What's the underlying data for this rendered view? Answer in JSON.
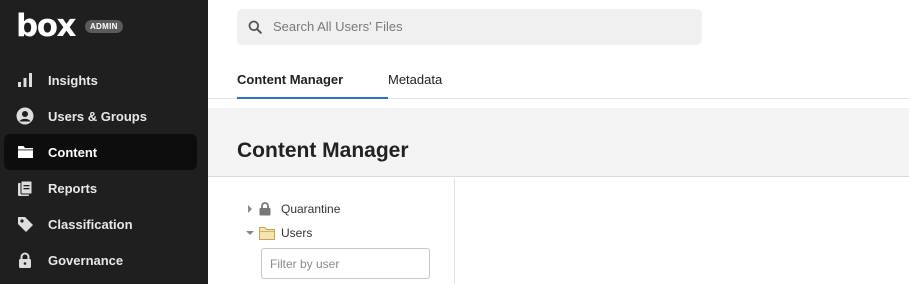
{
  "brand": {
    "logo_text": "box",
    "badge": "ADMIN"
  },
  "sidebar": {
    "items": [
      {
        "label": "Insights",
        "icon": "bar-chart-icon",
        "active": false
      },
      {
        "label": "Users & Groups",
        "icon": "user-icon",
        "active": false
      },
      {
        "label": "Content",
        "icon": "folder-icon",
        "active": true
      },
      {
        "label": "Reports",
        "icon": "reports-icon",
        "active": false
      },
      {
        "label": "Classification",
        "icon": "tag-icon",
        "active": false
      },
      {
        "label": "Governance",
        "icon": "lock-icon",
        "active": false
      }
    ]
  },
  "search": {
    "placeholder": "Search All Users' Files",
    "value": ""
  },
  "tabs": [
    {
      "label": "Content Manager",
      "active": true
    },
    {
      "label": "Metadata",
      "active": false
    }
  ],
  "page": {
    "title": "Content Manager"
  },
  "tree": {
    "items": [
      {
        "label": "Quarantine",
        "expanded": false,
        "icon": "lock-icon"
      },
      {
        "label": "Users",
        "expanded": true,
        "icon": "folder-icon"
      }
    ],
    "filter": {
      "placeholder": "Filter by user",
      "value": ""
    }
  },
  "colors": {
    "sidebar_bg": "#1f1f1f",
    "active_item_bg": "#0d0d0d",
    "tab_underline": "#2b74d6"
  }
}
